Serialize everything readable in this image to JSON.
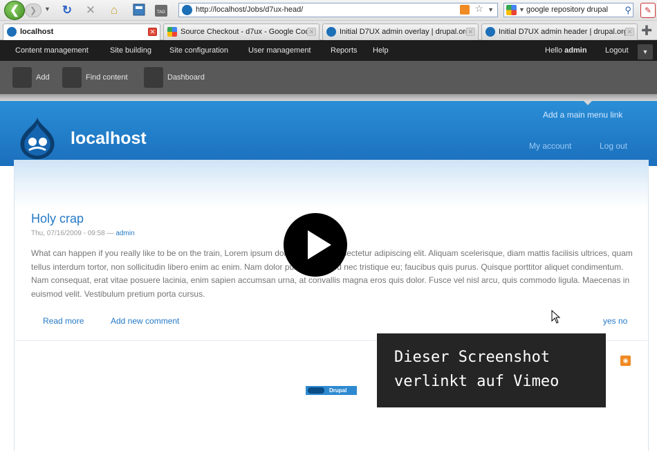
{
  "browser": {
    "url": "http://localhost/Jobs/d7ux-head/",
    "search_query": "google repository drupal",
    "tabs": [
      {
        "label": "localhost",
        "active": true
      },
      {
        "label": "Source Checkout - d7ux - Google Code",
        "active": false
      },
      {
        "label": "Initial D7UX admin overlay | drupal.org",
        "active": false
      },
      {
        "label": "Initial D7UX admin header | drupal.org",
        "active": false
      }
    ]
  },
  "admin_menu": {
    "items": [
      "Content management",
      "Site building",
      "Site configuration",
      "User management",
      "Reports",
      "Help"
    ],
    "greeting": "Hello",
    "username": "admin",
    "logout": "Logout"
  },
  "shortcuts": [
    "Add",
    "Find content",
    "Dashboard"
  ],
  "header": {
    "main_menu_link": "Add a main menu link",
    "site_name": "localhost",
    "secondary_links": [
      "My account",
      "Log out"
    ]
  },
  "node": {
    "title": "Holy crap",
    "date": "Thu, 07/16/2009 - 09:58",
    "separator": "—",
    "author": "admin",
    "body": "What can happen if you really like to be on the train, Lorem ipsum dolor sit amet, consectetur adipiscing elit. Aliquam scelerisque, diam mattis facilisis ultrices, quam tellus interdum tortor, non sollicitudin libero enim ac enim. Nam dolor purus; euismod nec tristique eu; faucibus quis purus. Quisque porttitor aliquet condimentum. Nam consequat, erat vitae posuere lacinia, enim sapien accumsan urna, at convallis magna eros quis dolor. Fusce vel nisl arcu, quis commodo ligula. Maecenas in euismod velit. Vestibulum pretium porta cursus.",
    "links": {
      "read_more": "Read more",
      "add_comment": "Add new comment",
      "yes_no": "yes no"
    }
  },
  "footer": {
    "powered_by": "Drupal"
  },
  "overlay": {
    "note": "Dieser Screenshot\nverlinkt auf Vimeo"
  },
  "colors": {
    "header_blue": "#2a8ed6",
    "link_blue": "#2479c6",
    "admin_dark": "#1e1e1e"
  }
}
